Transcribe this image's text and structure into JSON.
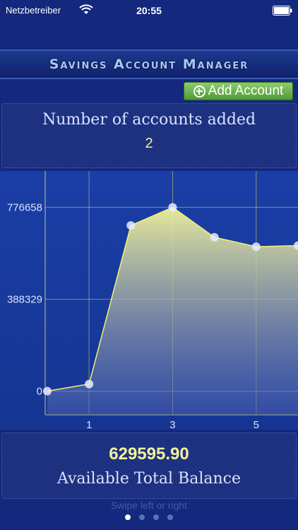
{
  "status_bar": {
    "carrier": "Netzbetreiber",
    "time": "20:55",
    "icons": [
      "wifi-icon",
      "battery-icon"
    ]
  },
  "header": {
    "title": "Savings Account Manager"
  },
  "toolbar": {
    "add_account_label": "Add Account",
    "add_icon": "plus-circle-icon"
  },
  "accounts": {
    "count_label": "Number of accounts added",
    "count_value": "2"
  },
  "chart_data": {
    "type": "area",
    "x": [
      0,
      1,
      2,
      3,
      4,
      5,
      6
    ],
    "y": [
      0,
      30000,
      700000,
      776658,
      650000,
      610000,
      615000
    ],
    "xticks": [
      "1",
      "3",
      "5"
    ],
    "xtick_values": [
      1,
      3,
      5
    ],
    "yticks": [
      "0",
      "388329",
      "776658"
    ],
    "ytick_values": [
      0,
      388329,
      776658
    ],
    "ylim": [
      -100000,
      900000
    ],
    "xlim": [
      -0.05,
      6
    ],
    "grid": true,
    "colors": {
      "line": "#f2f26a",
      "fill_top": "#f2f29a",
      "fill_bottom": "#4f63b5",
      "grid": "#c8c86a",
      "point": "#e8ecff"
    }
  },
  "balance": {
    "value": "629595.90",
    "label": "Available Total Balance"
  },
  "footer": {
    "hint": "Swipe left or right",
    "pages": 4,
    "active_page": 0
  }
}
